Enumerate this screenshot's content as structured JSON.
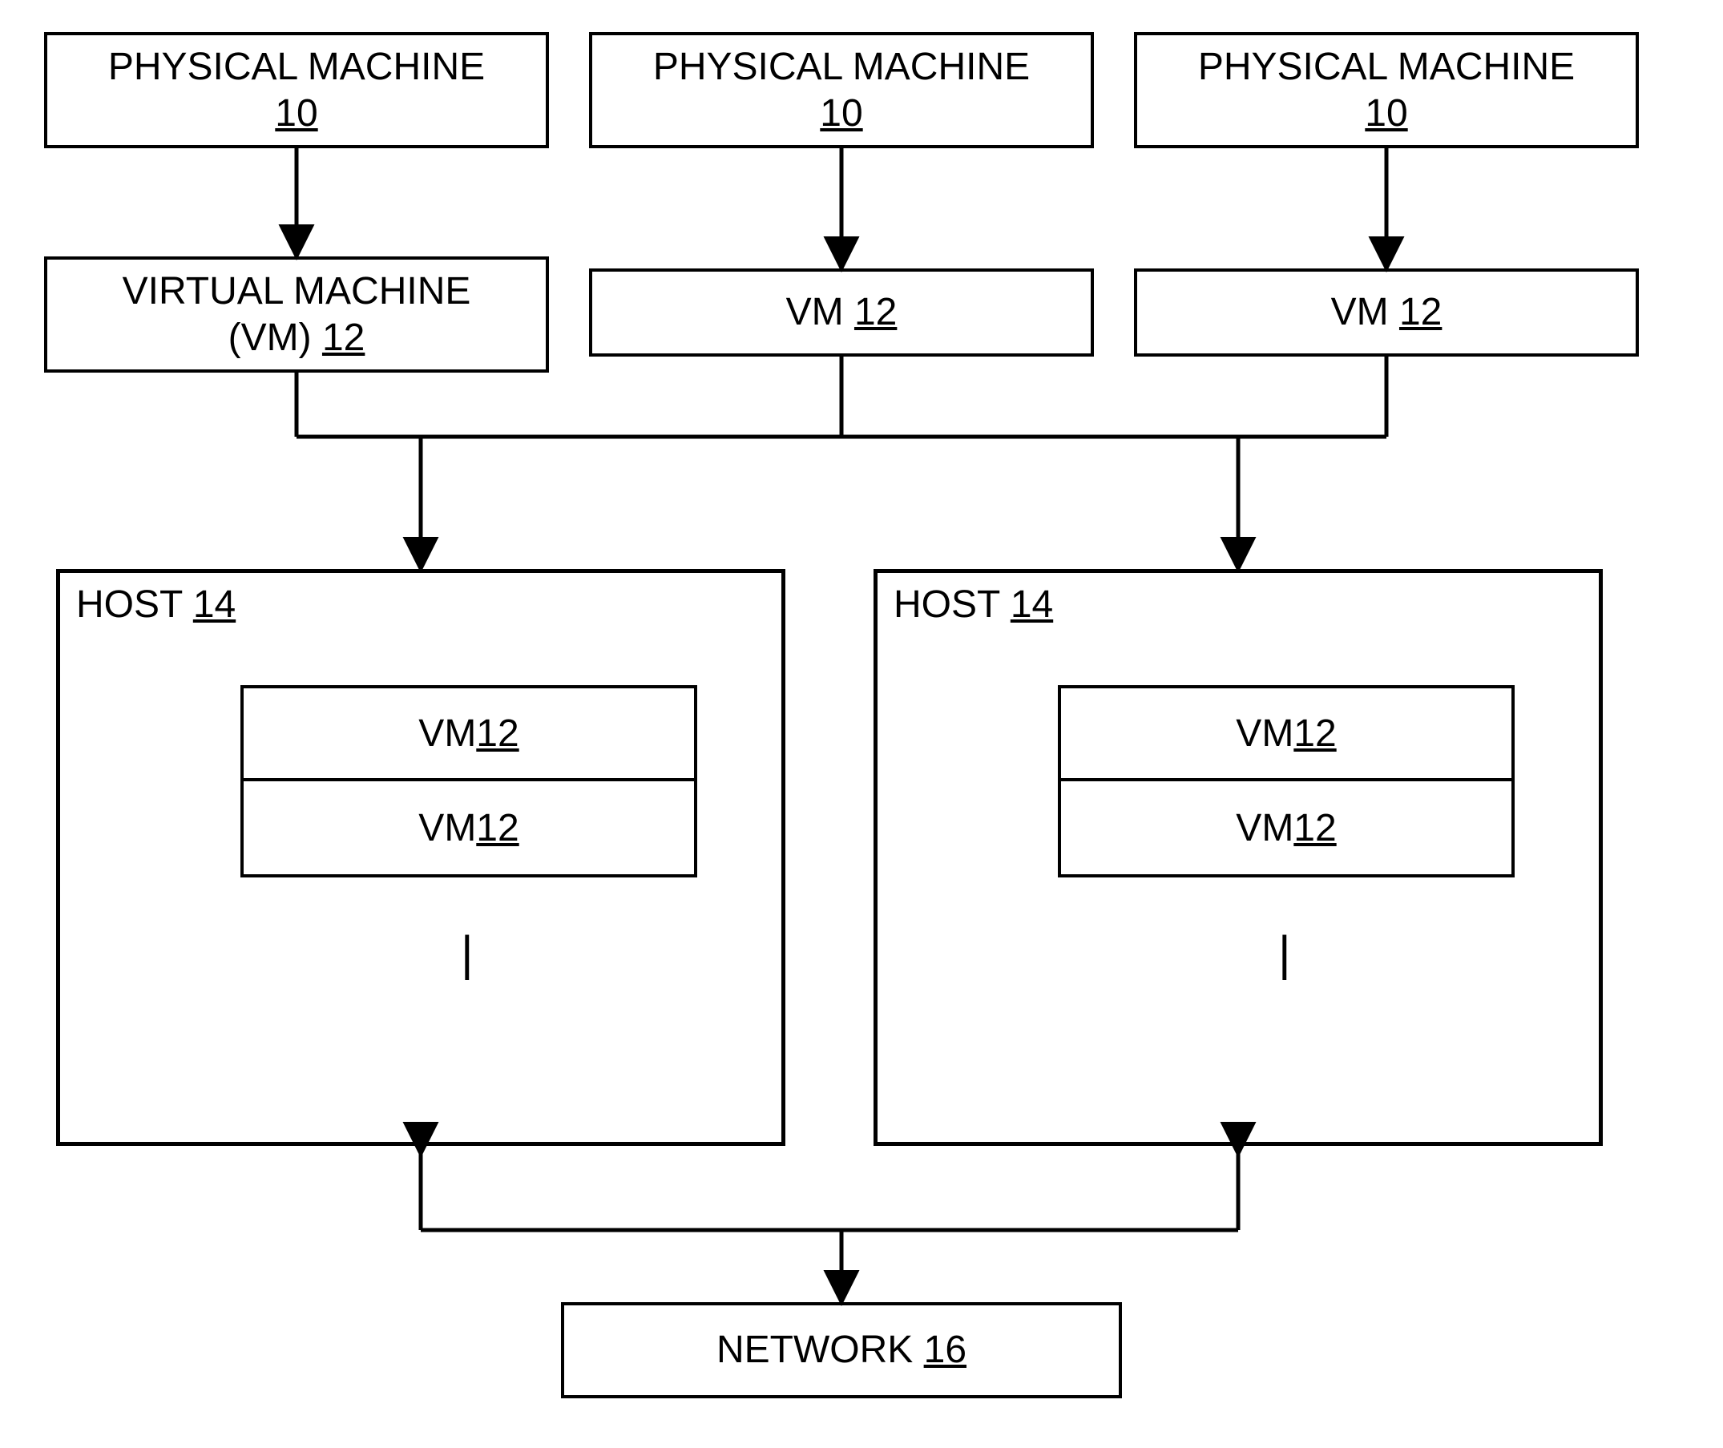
{
  "top": {
    "pm1": {
      "label": "PHYSICAL MACHINE",
      "num": "10"
    },
    "pm2": {
      "label": "PHYSICAL MACHINE",
      "num": "10"
    },
    "pm3": {
      "label": "PHYSICAL MACHINE",
      "num": "10"
    }
  },
  "mid": {
    "vm1": {
      "line1": "VIRTUAL MACHINE",
      "line2_prefix": "(VM) ",
      "num": "12"
    },
    "vm2": {
      "prefix": "VM ",
      "num": "12"
    },
    "vm3": {
      "prefix": "VM ",
      "num": "12"
    }
  },
  "hosts": {
    "h1": {
      "label_prefix": "HOST ",
      "num": "14",
      "vm_a": {
        "prefix": "VM ",
        "num": "12"
      },
      "vm_b": {
        "prefix": "VM ",
        "num": "12"
      },
      "ellipsis": "|"
    },
    "h2": {
      "label_prefix": "HOST ",
      "num": "14",
      "vm_a": {
        "prefix": "VM ",
        "num": "12"
      },
      "vm_b": {
        "prefix": "VM ",
        "num": "12"
      },
      "ellipsis": "|"
    }
  },
  "network": {
    "prefix": "NETWORK ",
    "num": "16"
  }
}
